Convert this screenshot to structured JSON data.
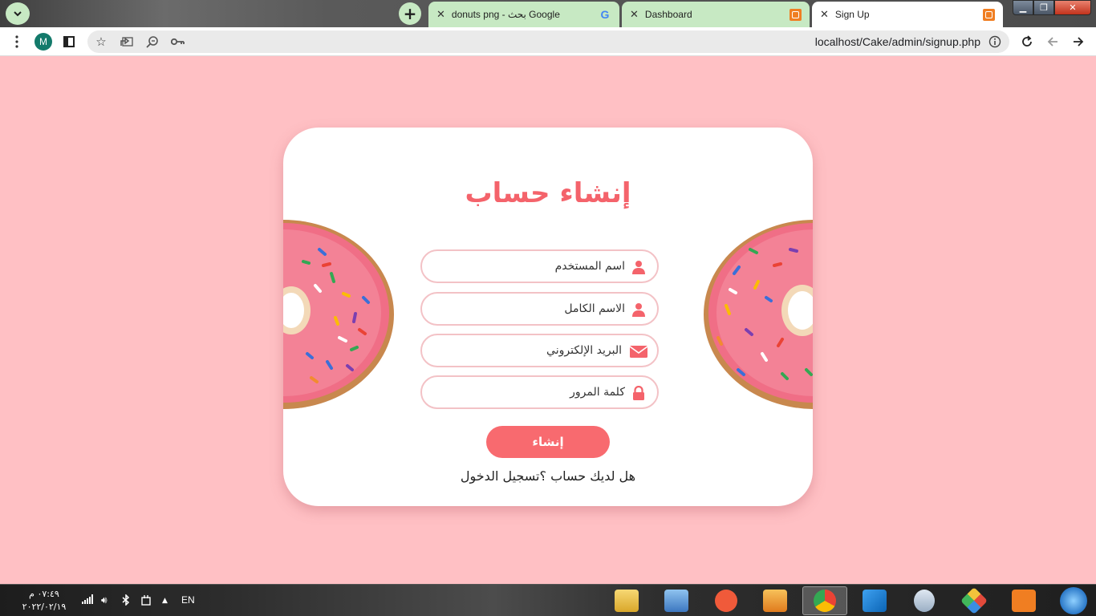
{
  "browser": {
    "tabs": [
      {
        "title": "donuts png - بحث Google",
        "active": false
      },
      {
        "title": "Dashboard",
        "active": false
      },
      {
        "title": "Sign Up",
        "active": true
      }
    ],
    "avatar_letter": "M",
    "url": "localhost/Cake/admin/signup.php",
    "tab_group_color": "#c7e9c3"
  },
  "page": {
    "background_color": "#ffc0c4",
    "accent_color": "#f4636b",
    "title": "إنشاء حساب",
    "fields": {
      "username": {
        "placeholder": "اسم المستخدم",
        "icon": "user-icon"
      },
      "fullname": {
        "placeholder": "الاسم الكامل",
        "icon": "user-icon"
      },
      "email": {
        "placeholder": "البريد الإلكتروني",
        "icon": "envelope-icon"
      },
      "password": {
        "placeholder": "كلمة المرور",
        "icon": "lock-icon"
      }
    },
    "submit_label": "إنشاء",
    "login_prompt": "هل لديك حساب ؟",
    "login_link": "تسجيل الدخول"
  },
  "taskbar": {
    "time": "٠٧:٤٩ م",
    "date": "٢٠٢٢/٠٢/١٩",
    "language": "EN"
  }
}
